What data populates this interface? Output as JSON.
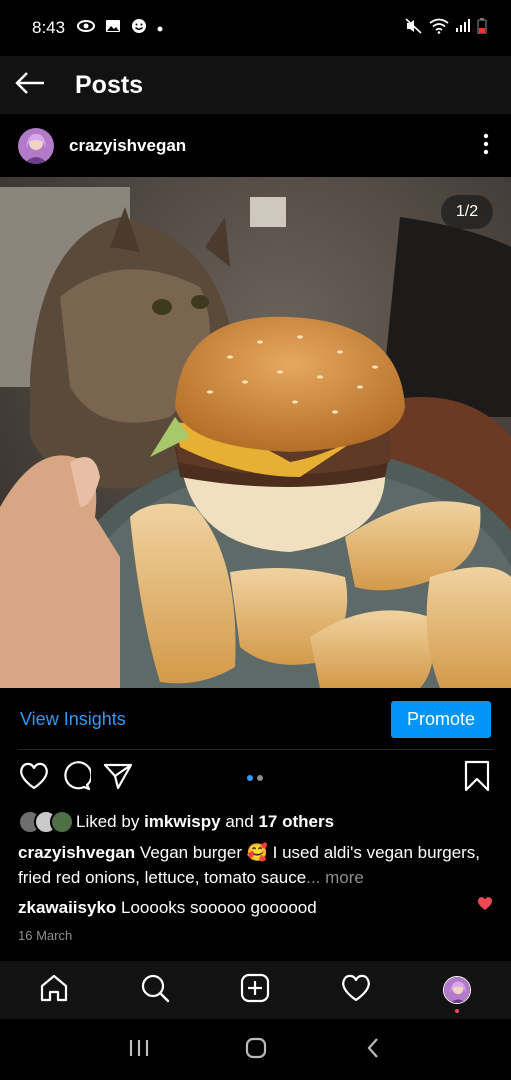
{
  "status_bar": {
    "time": "8:43"
  },
  "header": {
    "title": "Posts"
  },
  "post": {
    "username": "crazyishvegan",
    "photo_counter": "1/2",
    "active_dot_color": "#3897f0"
  },
  "insights": {
    "link": "View Insights",
    "promote": "Promote"
  },
  "likes": {
    "prefix": "Liked by",
    "user": "imkwispy",
    "middle": "and",
    "others": "17 others"
  },
  "caption": {
    "username": "crazyishvegan",
    "text_before_emoji": "Vegan burger",
    "emoji": "🥰",
    "text_after_emoji": "I used aldi's vegan burgers, fried red onions, lettuce, tomato sauce",
    "more": "... more"
  },
  "comment": {
    "username": "zkawaiisyko",
    "text": "Looooks sooooo goooood"
  },
  "date": "16 March",
  "colors": {
    "accent": "#0095f6",
    "link": "#3897f0",
    "heart": "#ed4956"
  },
  "icons": {
    "status": [
      "eye-icon",
      "gallery-icon",
      "emoji-icon",
      "mute-icon",
      "wifi-icon",
      "signal-icon",
      "battery-icon"
    ],
    "actions": [
      "heart-icon",
      "comment-icon",
      "share-icon",
      "bookmark-icon"
    ],
    "nav": [
      "home-icon",
      "search-icon",
      "add-icon",
      "activity-icon",
      "profile-avatar"
    ]
  }
}
